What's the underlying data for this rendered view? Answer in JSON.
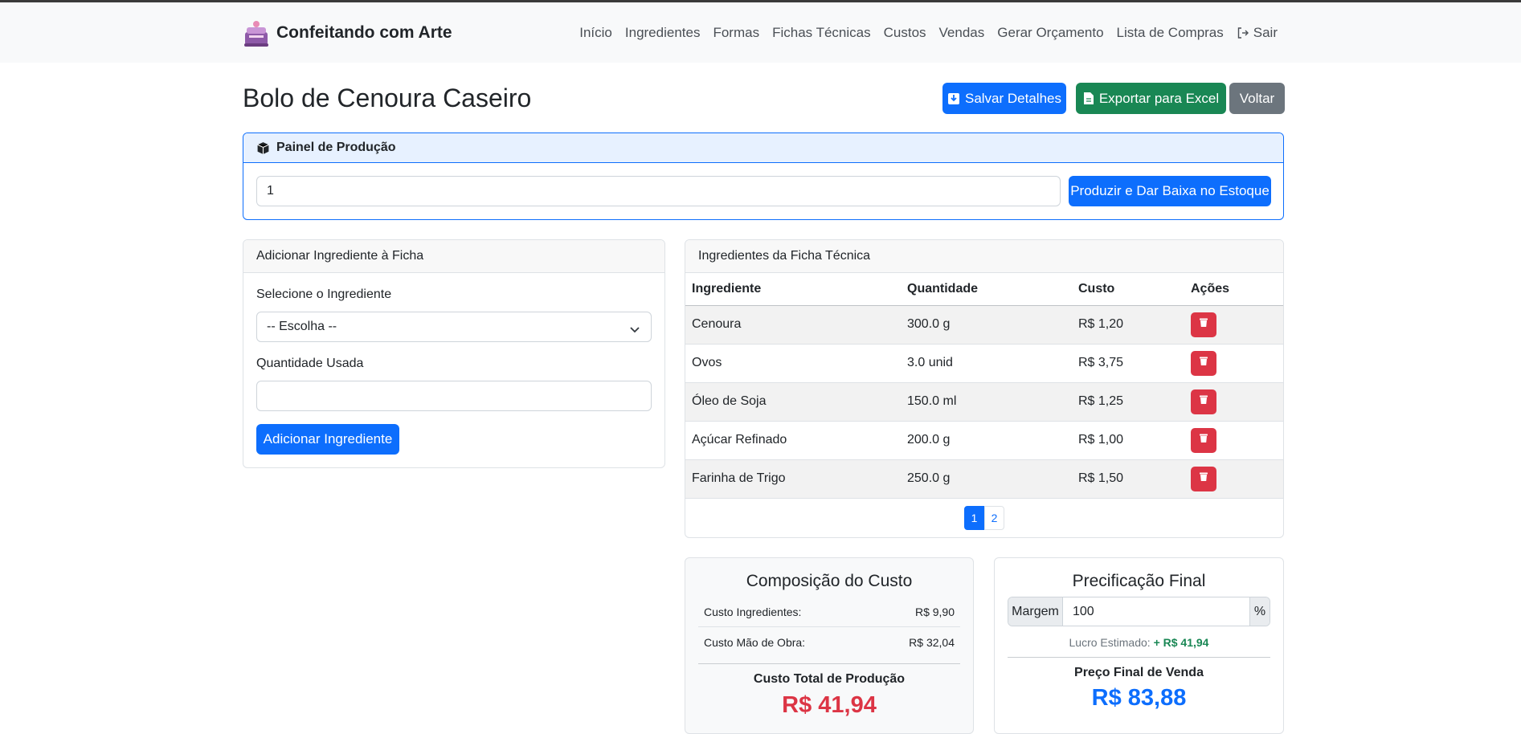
{
  "app": {
    "brand": "Confeitando com Arte",
    "nav": [
      {
        "label": "Início"
      },
      {
        "label": "Ingredientes"
      },
      {
        "label": "Formas"
      },
      {
        "label": "Fichas Técnicas"
      },
      {
        "label": "Custos"
      },
      {
        "label": "Vendas"
      },
      {
        "label": "Gerar Orçamento"
      },
      {
        "label": "Lista de Compras"
      },
      {
        "label": "Sair",
        "icon": "logout-icon"
      }
    ]
  },
  "page": {
    "title": "Bolo de Cenoura Caseiro",
    "actions": {
      "save": "Salvar Detalhes",
      "export": "Exportar para Excel",
      "back": "Voltar"
    }
  },
  "production": {
    "header": "Painel de Produção",
    "quantity_value": "1",
    "button": "Produzir e Dar Baixa no Estoque"
  },
  "add_ingredient": {
    "header": "Adicionar Ingrediente à Ficha",
    "select_label": "Selecione o Ingrediente",
    "select_value": "-- Escolha --",
    "quantity_label": "Quantidade Usada",
    "quantity_value": "",
    "button": "Adicionar Ingrediente"
  },
  "ingredients": {
    "header": "Ingredientes da Ficha Técnica",
    "columns": [
      "Ingrediente",
      "Quantidade",
      "Custo",
      "Ações"
    ],
    "rows": [
      {
        "name": "Cenoura",
        "qty": "300.0 g",
        "cost": "R$ 1,20"
      },
      {
        "name": "Ovos",
        "qty": "3.0 unid",
        "cost": "R$ 3,75"
      },
      {
        "name": "Óleo de Soja",
        "qty": "150.0 ml",
        "cost": "R$ 1,25"
      },
      {
        "name": "Açúcar Refinado",
        "qty": "200.0 g",
        "cost": "R$ 1,00"
      },
      {
        "name": "Farinha de Trigo",
        "qty": "250.0 g",
        "cost": "R$ 1,50"
      }
    ],
    "pagination": {
      "current": "1",
      "next": "2"
    }
  },
  "cost": {
    "title": "Composição do Custo",
    "ingredients_label": "Custo Ingredientes:",
    "ingredients_value": "R$ 9,90",
    "labor_label": "Custo Mão de Obra:",
    "labor_value": "R$ 32,04",
    "total_label": "Custo Total de Produção",
    "total_value": "R$ 41,94"
  },
  "pricing": {
    "title": "Precificação Final",
    "margin_label": "Margem",
    "margin_value": "100",
    "margin_unit": "%",
    "profit_label": "Lucro Estimado:",
    "profit_value": "+ R$ 41,94",
    "final_label": "Preço Final de Venda",
    "final_value": "R$ 83,88"
  },
  "colors": {
    "primary": "#0d6efd",
    "success": "#198754",
    "danger": "#dc3545",
    "secondary": "#6c757d"
  }
}
